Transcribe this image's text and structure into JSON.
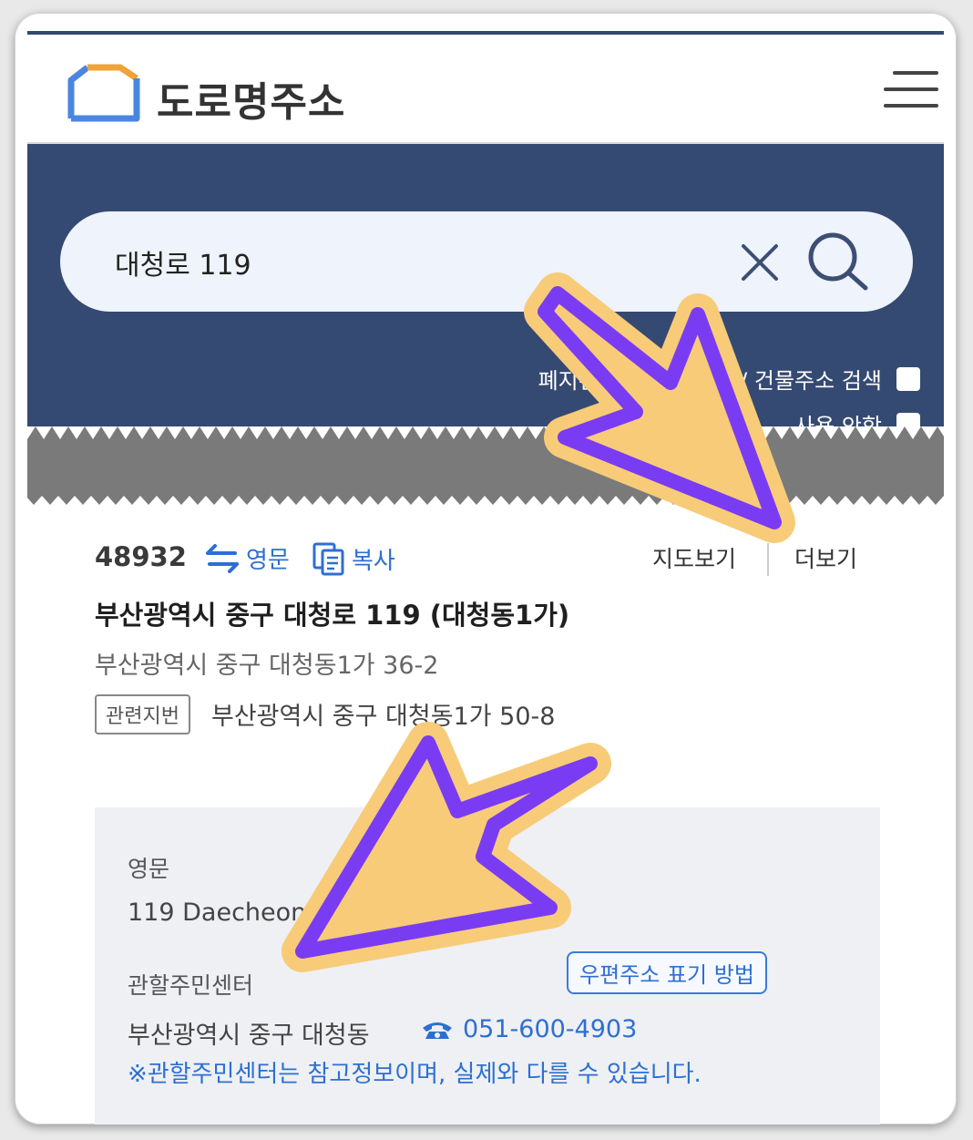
{
  "header": {
    "logo_text": "도로명주소",
    "logo_icon": "house-outline-icon",
    "menu_icon": "hamburger-menu-icon"
  },
  "search": {
    "value": "대청로 119",
    "clear_icon": "close-icon",
    "search_icon": "magnifier-icon",
    "option_1_label": "폐지된 주소정보 포함 / 건물주소 검색",
    "option_2_label": "사용 안함"
  },
  "result": {
    "zip": "48932",
    "eng_label": "영문",
    "copy_label": "복사",
    "map_label": "지도보기",
    "more_label": "더보기",
    "road_address": "부산광역시 중구 대청로 119 (대청동1가)",
    "jibun_address": "부산광역시 중구 대청동1가 36-2",
    "related_badge": "관련지번",
    "related_address": "부산광역시 중구 대청동1가 50-8"
  },
  "detail": {
    "eng_title": "영문",
    "eng_address": "119 Daecheong-ro, Jung-gu, Busan",
    "center_title": "관할주민센터",
    "postal_button": "우편주소 표기 방법",
    "center_value": "부산광역시 중구 대청동",
    "phone": "051-600-4903",
    "note": "※관할주민센터는 참고정보이며, 실제와 다를 수 있습니다."
  },
  "colors": {
    "navy": "#354a72",
    "link_blue": "#2d6fd1",
    "arrow_fill": "#f8cb78",
    "arrow_stroke": "#7a3cf2"
  }
}
